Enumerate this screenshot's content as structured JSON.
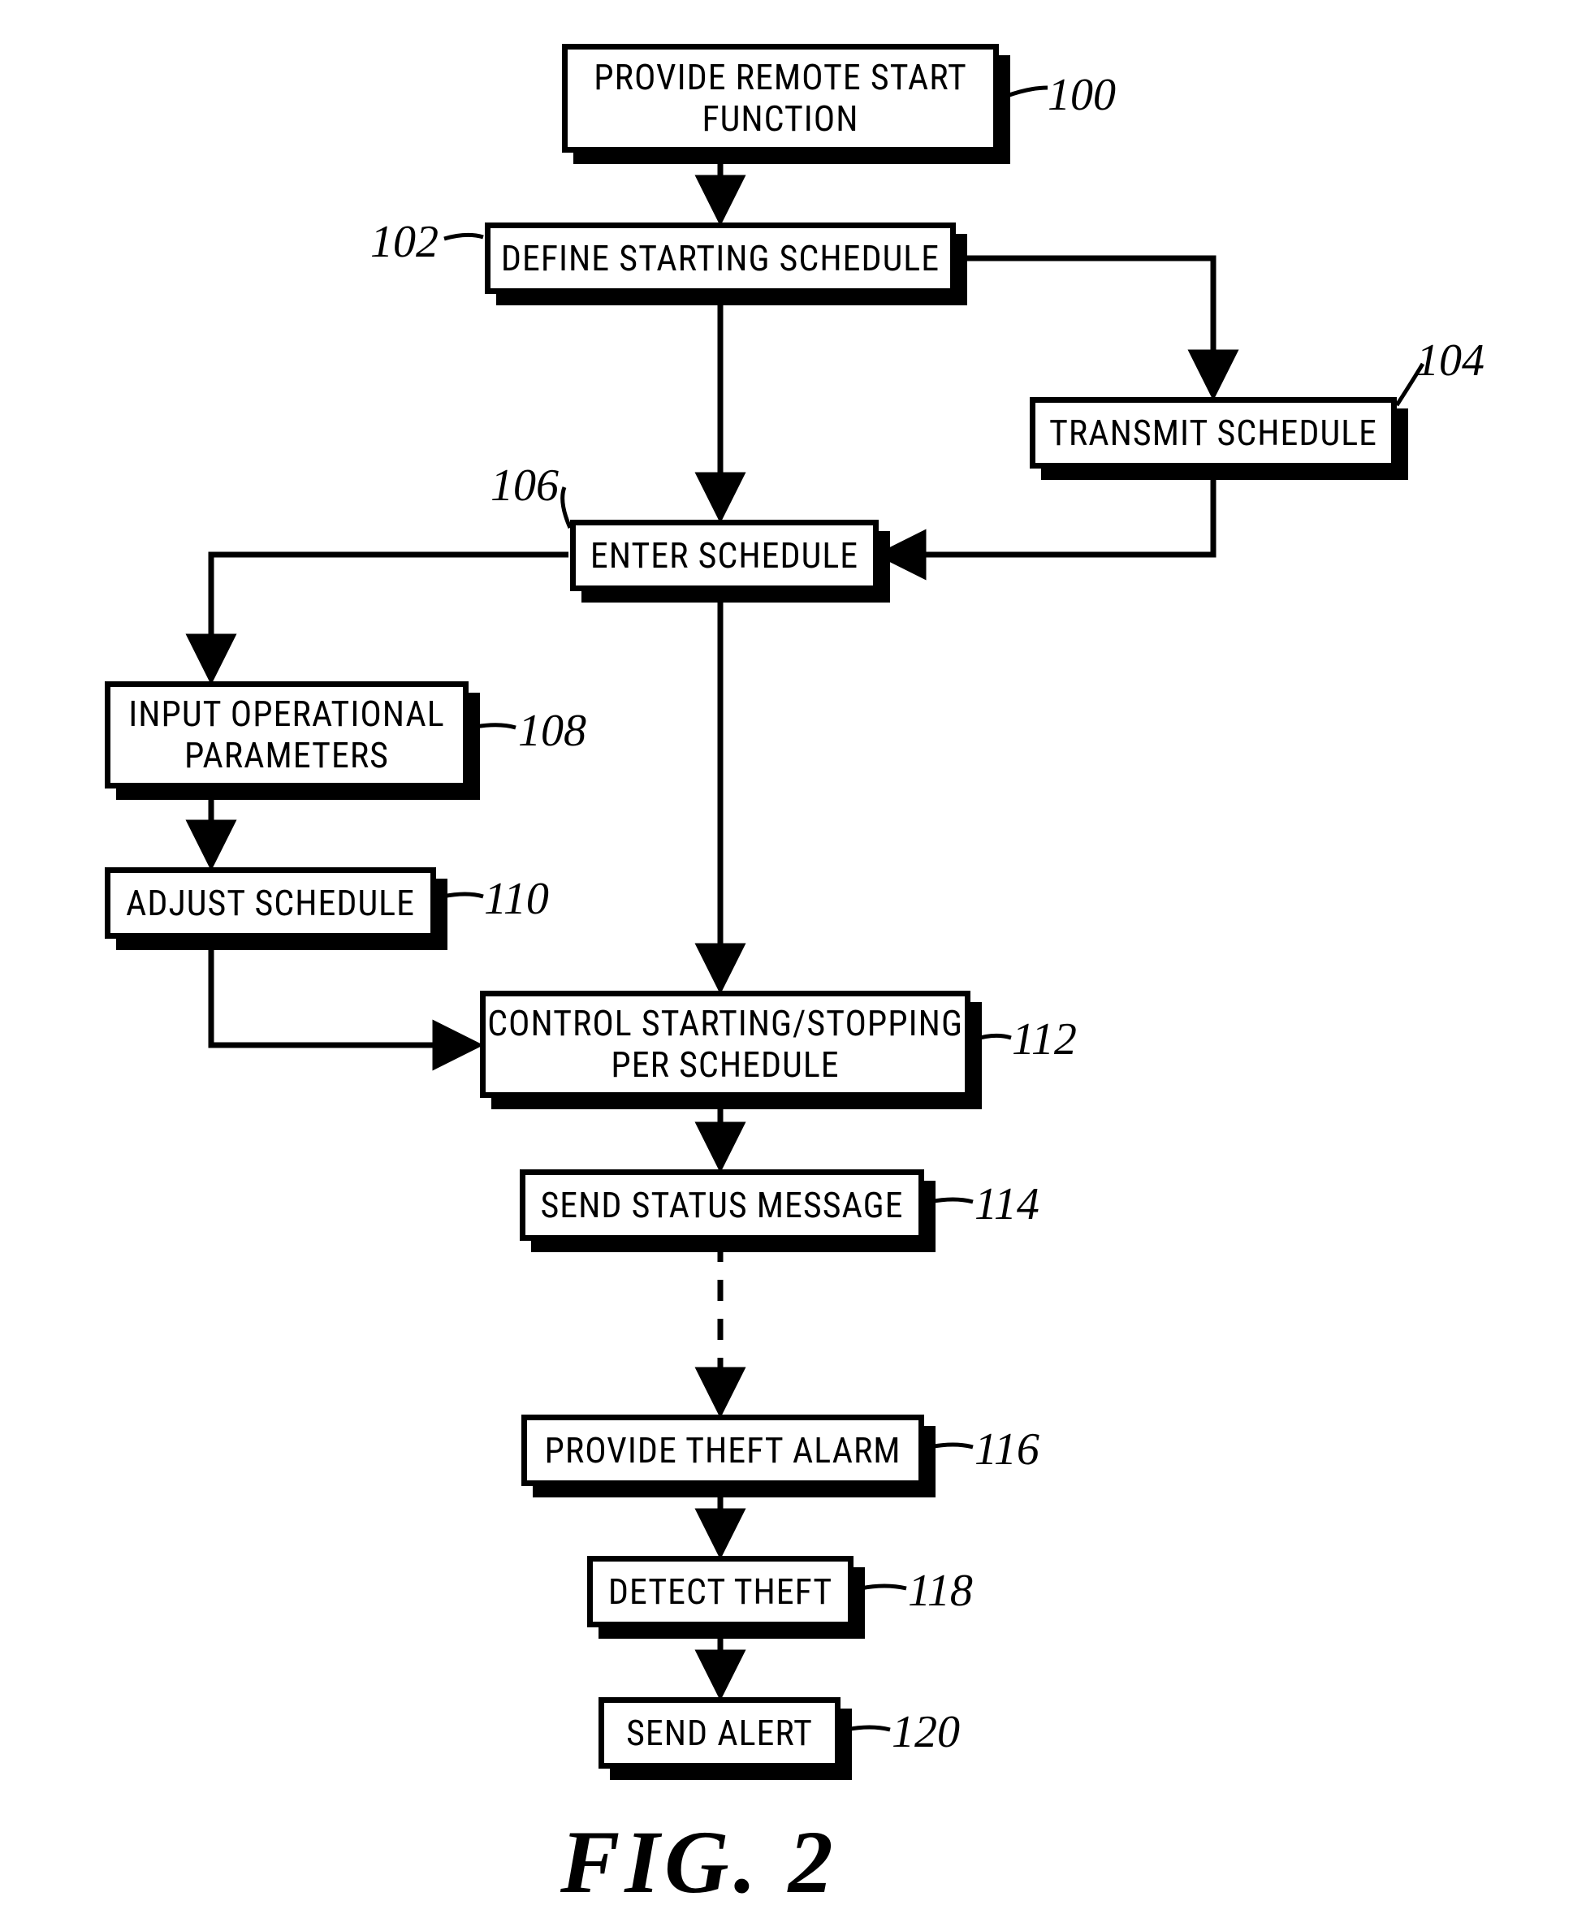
{
  "figure": "FIG.   2",
  "boxes": {
    "b100": "PROVIDE REMOTE START\nFUNCTION",
    "b102": "DEFINE STARTING SCHEDULE",
    "b104": "TRANSMIT SCHEDULE",
    "b106": "ENTER SCHEDULE",
    "b108": "INPUT OPERATIONAL\nPARAMETERS",
    "b110": "ADJUST SCHEDULE",
    "b112": "CONTROL STARTING/STOPPING\nPER SCHEDULE",
    "b114": "SEND STATUS MESSAGE",
    "b116": "PROVIDE THEFT ALARM",
    "b118": "DETECT THEFT",
    "b120": "SEND ALERT"
  },
  "refs": {
    "r100": "100",
    "r102": "102",
    "r104": "104",
    "r106": "106",
    "r108": "108",
    "r110": "110",
    "r112": "112",
    "r114": "114",
    "r116": "116",
    "r118": "118",
    "r120": "120"
  }
}
